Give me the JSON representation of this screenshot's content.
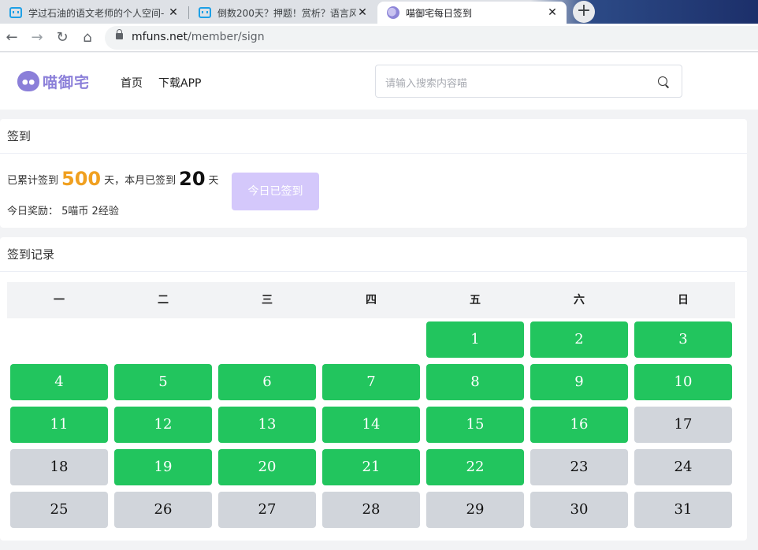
{
  "browser": {
    "tabs": [
      {
        "title": "学过石油的语文老师的个人空间-",
        "close": "✕"
      },
      {
        "title": "倒数200天？押题！赏析？语言风",
        "close": "✕"
      },
      {
        "title": "喵御宅每日签到",
        "close": "✕"
      }
    ],
    "new_tab": "+",
    "url_host": "mfuns.net",
    "url_path": "/member/sign"
  },
  "site": {
    "logo_text": "喵御宅",
    "nav": [
      "首页",
      "下载APP"
    ],
    "search_placeholder": "请输入搜索内容喵"
  },
  "sign": {
    "title": "签到",
    "prefix": "已累计签到",
    "total_days": "500",
    "unit1": "天，本月已签到",
    "month_days": "20",
    "unit2": "天",
    "reward_label": "今日奖励：",
    "reward_value": "5喵币 2经验",
    "button_label": "今日已签到"
  },
  "record": {
    "title": "签到记录",
    "weekdays": [
      "一",
      "二",
      "三",
      "四",
      "五",
      "六",
      "日"
    ],
    "leading_empty": 4,
    "days": [
      {
        "d": "1",
        "signed": true
      },
      {
        "d": "2",
        "signed": true
      },
      {
        "d": "3",
        "signed": true
      },
      {
        "d": "4",
        "signed": true
      },
      {
        "d": "5",
        "signed": true
      },
      {
        "d": "6",
        "signed": true
      },
      {
        "d": "7",
        "signed": true
      },
      {
        "d": "8",
        "signed": true
      },
      {
        "d": "9",
        "signed": true
      },
      {
        "d": "10",
        "signed": true
      },
      {
        "d": "11",
        "signed": true
      },
      {
        "d": "12",
        "signed": true
      },
      {
        "d": "13",
        "signed": true
      },
      {
        "d": "14",
        "signed": true
      },
      {
        "d": "15",
        "signed": true
      },
      {
        "d": "16",
        "signed": true
      },
      {
        "d": "17",
        "signed": false
      },
      {
        "d": "18",
        "signed": false
      },
      {
        "d": "19",
        "signed": true
      },
      {
        "d": "20",
        "signed": true
      },
      {
        "d": "21",
        "signed": true
      },
      {
        "d": "22",
        "signed": true
      },
      {
        "d": "23",
        "signed": false
      },
      {
        "d": "24",
        "signed": false
      },
      {
        "d": "25",
        "signed": false
      },
      {
        "d": "26",
        "signed": false
      },
      {
        "d": "27",
        "signed": false
      },
      {
        "d": "28",
        "signed": false
      },
      {
        "d": "29",
        "signed": false
      },
      {
        "d": "30",
        "signed": false
      },
      {
        "d": "31",
        "signed": false
      }
    ],
    "colors": {
      "signed": "#22c55e",
      "unsigned": "#d1d5db"
    }
  }
}
